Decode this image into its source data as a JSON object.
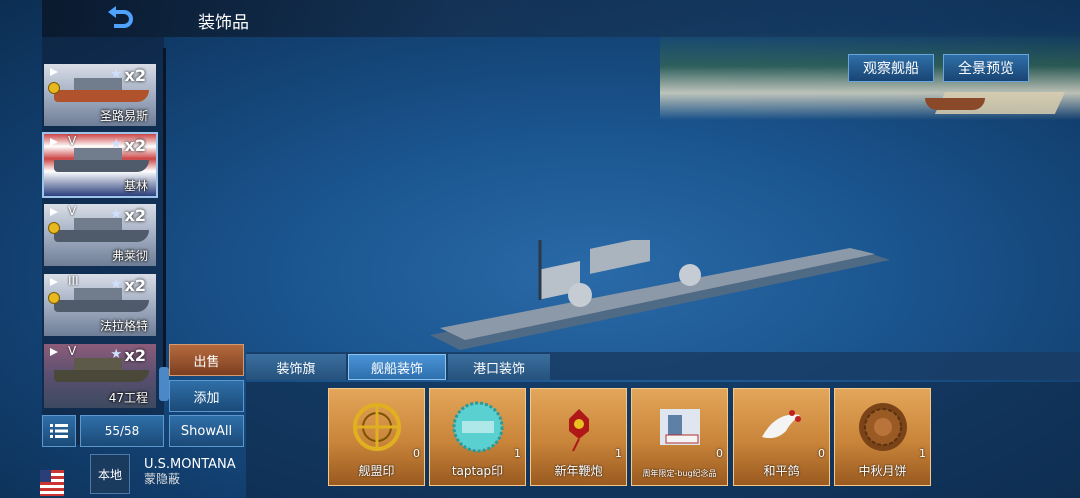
{
  "header": {
    "title": "装饰品"
  },
  "top_buttons": {
    "observe": "观察舰船",
    "panorama": "全景预览"
  },
  "ship_list": [
    {
      "tier": "",
      "stars": "★",
      "count": "x2",
      "name": "圣路易斯"
    },
    {
      "tier": "V",
      "stars": "★",
      "count": "x2",
      "name": "基林"
    },
    {
      "tier": "V",
      "stars": "★",
      "count": "x2",
      "name": "弗莱彻"
    },
    {
      "tier": "III",
      "stars": "★",
      "count": "x2",
      "name": "法拉格特"
    },
    {
      "tier": "V",
      "stars": "★",
      "count": "x2",
      "name": "47工程"
    }
  ],
  "actions": {
    "sell": "出售",
    "add": "添加",
    "show_all": "ShowAll",
    "count": "55/58",
    "local": "本地"
  },
  "current_ship": {
    "name": "U.S.MONTANA",
    "sub": "蒙隐蔽"
  },
  "tabs": [
    {
      "label": "装饰旗"
    },
    {
      "label": "舰船装饰"
    },
    {
      "label": "港口装饰"
    }
  ],
  "items": [
    {
      "label": "舰盟印",
      "qty": "0",
      "icon": "alliance-seal-icon"
    },
    {
      "label": "taptap印",
      "qty": "1",
      "icon": "taptap-seal-icon"
    },
    {
      "label": "新年鞭炮",
      "qty": "1",
      "icon": "firecracker-icon"
    },
    {
      "label": "周年限定-bug纪念品",
      "qty": "0",
      "icon": "bug-souvenir-icon"
    },
    {
      "label": "和平鸽",
      "qty": "0",
      "icon": "peace-dove-icon"
    },
    {
      "label": "中秋月饼",
      "qty": "1",
      "icon": "mooncake-icon"
    }
  ]
}
